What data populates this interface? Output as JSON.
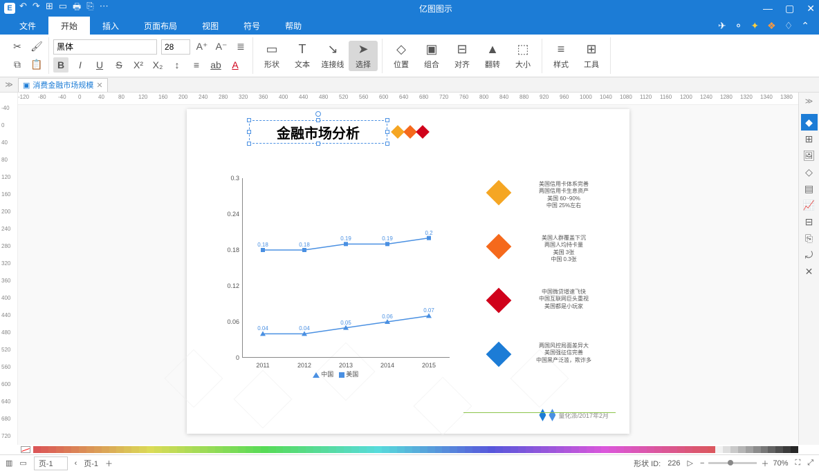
{
  "app": {
    "title": "亿图图示"
  },
  "qat": [
    "↶",
    "↷",
    "⊞",
    "▭",
    "🖶",
    "⎘",
    "⋯"
  ],
  "wincontrols": {
    "min": "—",
    "max": "▢",
    "close": "✕"
  },
  "menu": {
    "tabs": [
      "文件",
      "开始",
      "插入",
      "页面布局",
      "视图",
      "符号",
      "帮助"
    ],
    "active": 1,
    "right_icons": [
      "✈",
      "⚬",
      "✦",
      "❖",
      "♢",
      "⌃"
    ]
  },
  "ribbon": {
    "clipboard": {
      "cut": "✂",
      "format": "🖌",
      "copy": "⧉",
      "paste": "📋"
    },
    "font": {
      "name": "黑体",
      "size": "28",
      "inc": "A⁺",
      "dec": "A⁻",
      "align": "≣",
      "bold": "B",
      "italic": "I",
      "under": "U",
      "strike": "S",
      "sup": "X²",
      "sub": "X₂",
      "spacing": "↕",
      "list": "≡",
      "hi": "ab",
      "color": "A"
    },
    "tools": [
      {
        "id": "shape",
        "label": "形状",
        "ico": "▭"
      },
      {
        "id": "text",
        "label": "文本",
        "ico": "T"
      },
      {
        "id": "connector",
        "label": "连接线",
        "ico": "↘"
      },
      {
        "id": "select",
        "label": "选择",
        "ico": "➤",
        "active": true
      },
      {
        "id": "position",
        "label": "位置",
        "ico": "◇"
      },
      {
        "id": "group",
        "label": "组合",
        "ico": "▣"
      },
      {
        "id": "align",
        "label": "对齐",
        "ico": "⊟"
      },
      {
        "id": "flip",
        "label": "翻转",
        "ico": "▲"
      },
      {
        "id": "size",
        "label": "大小",
        "ico": "⬚"
      },
      {
        "id": "style",
        "label": "样式",
        "ico": "≡"
      },
      {
        "id": "tool",
        "label": "工具",
        "ico": "⊞"
      }
    ]
  },
  "doctab": {
    "name": "消费金融市场规模"
  },
  "hruler": [
    -120,
    -80,
    -40,
    0,
    40,
    80,
    120,
    160,
    200,
    240,
    280,
    320,
    360,
    400,
    440,
    480,
    520,
    560,
    600,
    640,
    680,
    720,
    760,
    800,
    840,
    880,
    920,
    960,
    1000,
    1040,
    1080,
    1120,
    1160,
    1200,
    1240,
    1280,
    1320,
    1340,
    1380
  ],
  "vruler": [
    -40,
    0,
    40,
    80,
    120,
    160,
    200,
    240,
    280,
    320,
    360,
    400,
    440,
    480,
    520,
    560,
    600,
    640,
    680,
    720
  ],
  "document": {
    "title": "金融市场分析",
    "chart_data": {
      "type": "line",
      "categories": [
        "2011",
        "2012",
        "2013",
        "2014",
        "2015"
      ],
      "series": [
        {
          "name": "中国",
          "values": [
            0.04,
            0.04,
            0.05,
            0.06,
            0.07
          ]
        },
        {
          "name": "美国",
          "values": [
            0.18,
            0.18,
            0.19,
            0.19,
            0.2
          ]
        }
      ],
      "ylim": [
        0,
        0.3
      ],
      "yticks": [
        0,
        0.06,
        0.12,
        0.18,
        0.24,
        0.3
      ],
      "legend": [
        "中国",
        "美国"
      ]
    },
    "notes": [
      {
        "color": "#f5a623",
        "lines": [
          "美国信用卡体系完善",
          "两国信用卡生息资产",
          "美国 60~90%",
          "中国 25%左右"
        ]
      },
      {
        "color": "#f5691c",
        "lines": [
          "美国人群覆盖下沉",
          "两国人均持卡量",
          "美国 3张",
          "中国 0.3张"
        ]
      },
      {
        "color": "#d0021b",
        "lines": [
          "中国微贷增速飞快",
          "中国互联网巨头重视",
          "美国都是小玩家"
        ]
      },
      {
        "color": "#1c7cd6",
        "lines": [
          "两国风控局面差异大",
          "美国强征信完善",
          "中国黑产泛滥，欺诈多"
        ]
      }
    ],
    "footer": "量化派/2017年2月"
  },
  "sidepanel": [
    "◆",
    "⊞",
    "🖼",
    "◇",
    "▤",
    "📈",
    "⊟",
    "⎘",
    "⤾",
    "✕"
  ],
  "statusbar": {
    "page_sel": "页-1",
    "page_label": "页-1",
    "shape_id_label": "形状 ID:",
    "shape_id": "226",
    "zoom": "70%"
  }
}
